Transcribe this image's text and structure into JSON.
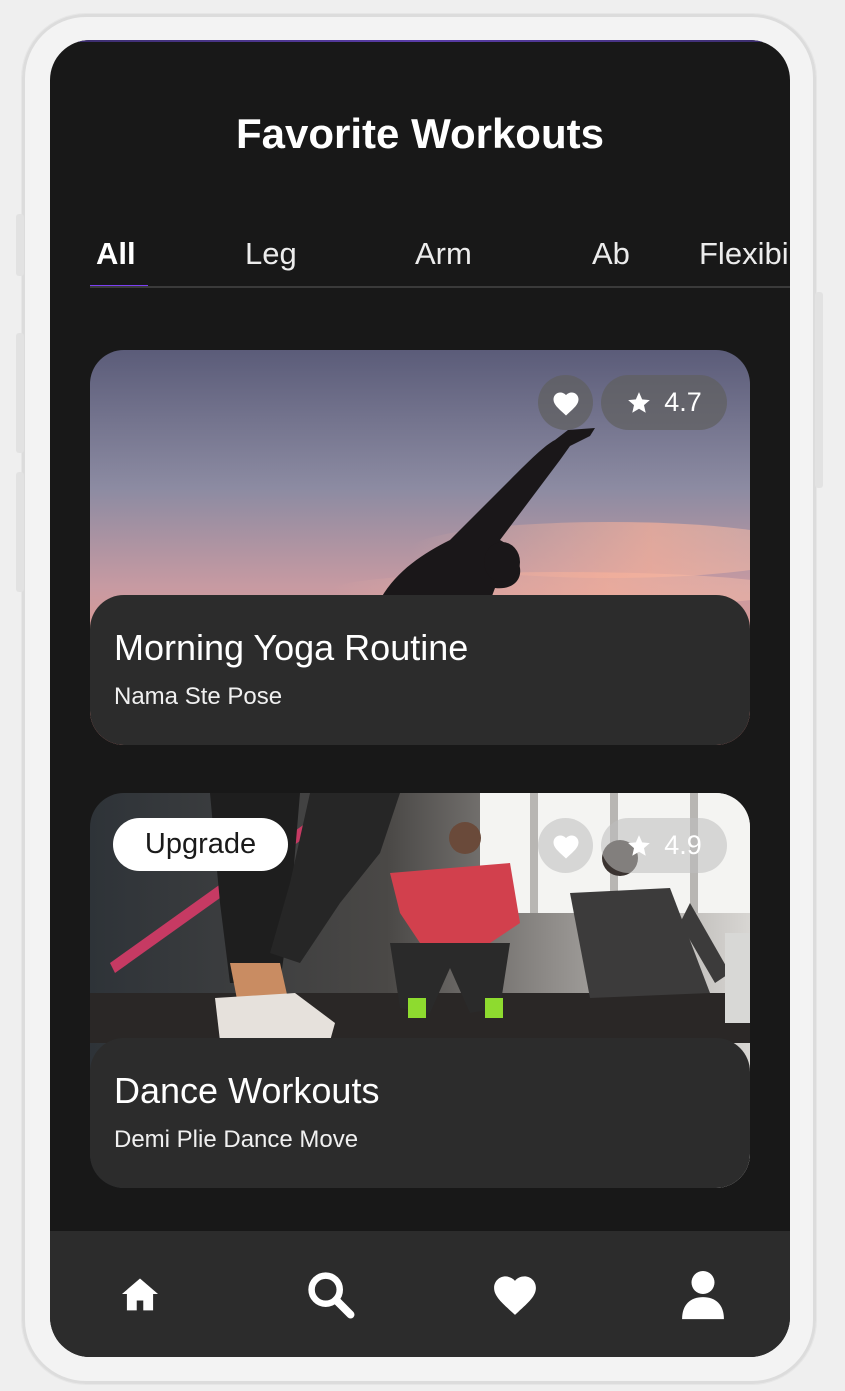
{
  "header": {
    "title": "Favorite Workouts"
  },
  "tabs": [
    {
      "label": "All",
      "active": true
    },
    {
      "label": "Leg",
      "active": false
    },
    {
      "label": "Arm",
      "active": false
    },
    {
      "label": "Ab",
      "active": false
    },
    {
      "label": "Flexibility",
      "active": false
    }
  ],
  "cards": [
    {
      "title": "Morning Yoga Routine",
      "subtitle": "Nama Ste Pose",
      "rating": "4.7",
      "upgrade": null,
      "image": "yoga-silhouette-sunset-photo"
    },
    {
      "title": "Dance Workouts",
      "subtitle": "Demi Plie Dance Move",
      "rating": "4.9",
      "upgrade": "Upgrade",
      "image": "gym-group-workout-photo"
    }
  ],
  "bottom_nav": [
    {
      "icon": "home-icon"
    },
    {
      "icon": "search-icon"
    },
    {
      "icon": "heart-icon"
    },
    {
      "icon": "profile-icon"
    }
  ],
  "colors": {
    "background": "#181818",
    "card": "#2c2c2c",
    "accent": "#7b3ff2",
    "text": "#ffffff"
  }
}
